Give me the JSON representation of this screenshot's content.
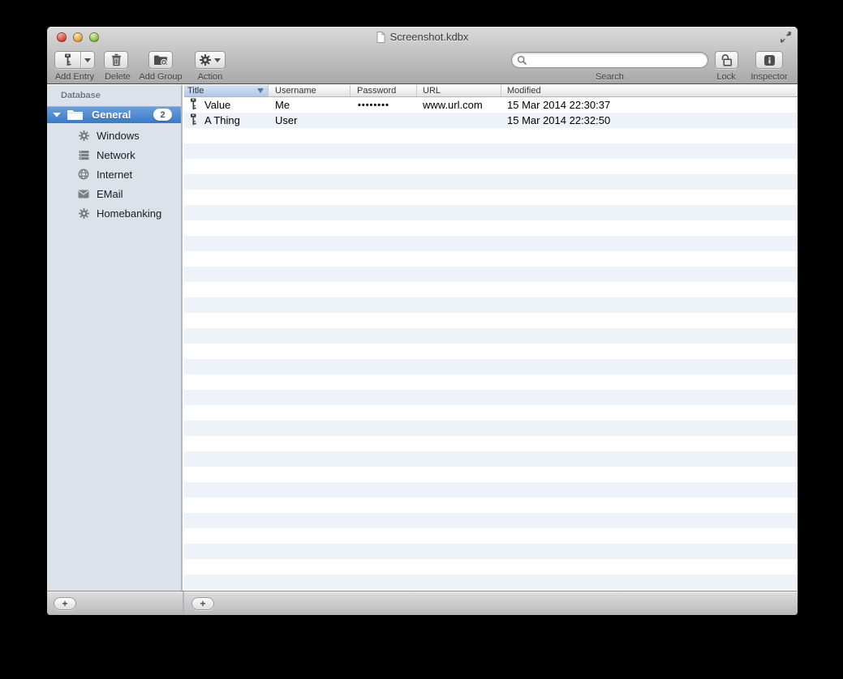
{
  "window": {
    "title": "Screenshot.kdbx"
  },
  "toolbar": {
    "add_entry_label": "Add Entry",
    "delete_label": "Delete",
    "add_group_label": "Add Group",
    "action_label": "Action",
    "search_label": "Search",
    "search_value": "",
    "lock_label": "Lock",
    "inspector_label": "Inspector"
  },
  "sidebar": {
    "header": "Database",
    "root_group": {
      "label": "General",
      "badge": "2",
      "icon": "folder-icon",
      "selected": true
    },
    "items": [
      {
        "label": "Windows",
        "icon": "gear-icon"
      },
      {
        "label": "Network",
        "icon": "network-stack-icon"
      },
      {
        "label": "Internet",
        "icon": "globe-icon"
      },
      {
        "label": "EMail",
        "icon": "envelope-icon"
      },
      {
        "label": "Homebanking",
        "icon": "gear-icon"
      }
    ]
  },
  "table": {
    "columns": [
      "Title",
      "Username",
      "Password",
      "URL",
      "Modified"
    ],
    "sort_column": "Title",
    "sort_direction": "descending",
    "rows": [
      {
        "icon": "key-icon",
        "title": "Value",
        "username": "Me",
        "password": "••••••••",
        "url": "www.url.com",
        "modified": "15 Mar 2014 22:30:37"
      },
      {
        "icon": "key-icon",
        "title": "A Thing",
        "username": "User",
        "password": "",
        "url": "",
        "modified": "15 Mar 2014 22:32:50"
      }
    ]
  },
  "footer": {
    "sidebar_add_label": "+",
    "main_add_label": "+"
  },
  "colors": {
    "selection_blue_top": "#6ba1dc",
    "selection_blue_bottom": "#3a79ca",
    "sidebar_background": "#dbe2ea",
    "row_stripe": "#eef3f9",
    "sorted_header_top": "#d6e3f4",
    "sorted_header_bottom": "#aec8e8"
  }
}
